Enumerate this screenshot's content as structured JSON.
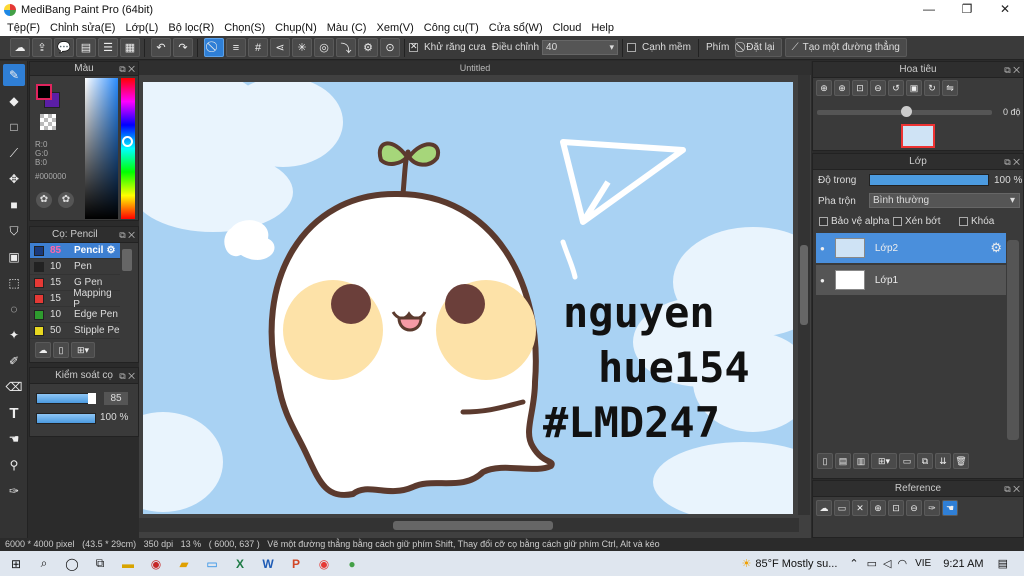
{
  "window": {
    "title": "MediBang Paint Pro (64bit)"
  },
  "menu": [
    "Tệp(F)",
    "Chỉnh sửa(E)",
    "Lớp(L)",
    "Bộ lọc(R)",
    "Chọn(S)",
    "Chụp(N)",
    "Màu (C)",
    "Xem(V)",
    "Công cụ(T)",
    "Cửa sổ(W)",
    "Cloud",
    "Help"
  ],
  "toolbar": {
    "antialias_label": "Khử răng cưa",
    "adjust_label": "Điều chỉnh",
    "adjust_value": "40",
    "smooth_label": "Cạnh mềm",
    "key_label": "Phím",
    "reset_label": "Đặt lại",
    "straight_line_label": "Tạo một đường thẳng"
  },
  "color_panel": {
    "title": "Màu",
    "r": "R:0",
    "g": "G:0",
    "b": "B:0",
    "hex": "#000000",
    "foreground": "#000000",
    "background": "#5b1ea6"
  },
  "brush_panel": {
    "title": "Cọ: Pencil",
    "items": [
      {
        "size": "85",
        "name": "Pencil",
        "color": "#1a3a7a"
      },
      {
        "size": "10",
        "name": "Pen",
        "color": "#222222"
      },
      {
        "size": "15",
        "name": "G Pen",
        "color": "#e53935"
      },
      {
        "size": "15",
        "name": "Mapping P",
        "color": "#e53935"
      },
      {
        "size": "10",
        "name": "Edge Pen",
        "color": "#2e9b2e"
      },
      {
        "size": "50",
        "name": "Stipple Pe",
        "color": "#e8d820"
      }
    ]
  },
  "control_panel": {
    "title": "Kiểm soát cọ",
    "size_value": "85",
    "opacity_value": "100 %"
  },
  "canvas": {
    "tab_title": "Untitled",
    "handwriting": [
      "nguyen",
      "hue154",
      "#LMD247"
    ]
  },
  "navigator": {
    "title": "Hoa tiêu",
    "angle": "0 độ"
  },
  "layer_panel": {
    "title": "Lớp",
    "opacity_label": "Độ trong",
    "opacity_value": "100 %",
    "blend_label": "Pha trộn",
    "blend_value": "Bình thường",
    "protect_alpha": "Bảo vệ alpha",
    "clip": "Xén bớt",
    "lock": "Khóa",
    "layers": [
      "Lớp2",
      "Lớp1"
    ]
  },
  "reference_panel": {
    "title": "Reference"
  },
  "status": {
    "size": "6000 * 4000 pixel",
    "cm": "(43.5 * 29cm)",
    "dpi": "350 dpi",
    "zoom": "13 %",
    "coord": "( 6000, 637 )",
    "hint": "Vẽ một đường thẳng bằng cách giữ phím Shift, Thay đổi cỡ cọ bằng cách giữ phím Ctrl, Alt và kéo"
  },
  "taskbar": {
    "weather": "85°F  Mostly su...",
    "lang": "VIE",
    "time": "9:21 AM"
  }
}
